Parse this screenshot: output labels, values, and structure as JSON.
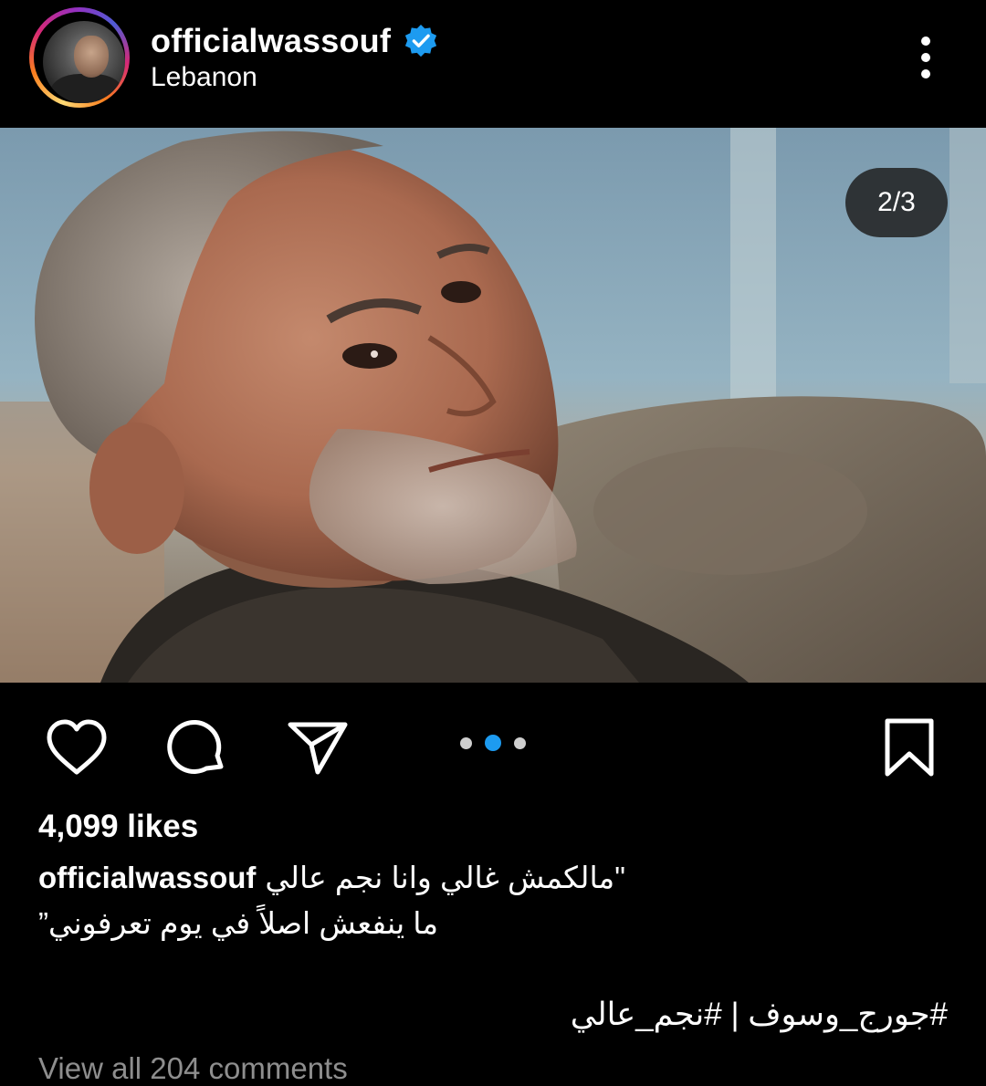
{
  "header": {
    "username": "officialwassouf",
    "location": "Lebanon",
    "verified_color": "#1d9bf0"
  },
  "post": {
    "image_counter": "2/3",
    "active_slide": 2,
    "slide_count": 3
  },
  "actions": {
    "like_icon": "heart-icon",
    "comment_icon": "comment-icon",
    "share_icon": "paper-plane-icon",
    "save_icon": "bookmark-icon"
  },
  "caption": {
    "likes": "4,099 likes",
    "username": "officialwassouf",
    "line1": "\"مالكمش غالي وانا نجم عالي",
    "line2": "ما ينفعش اصلاً في يوم تعرفوني”",
    "hashtags": "#جورج_وسوف | #نجم_عالي",
    "view_comments": "View all 204 comments"
  }
}
